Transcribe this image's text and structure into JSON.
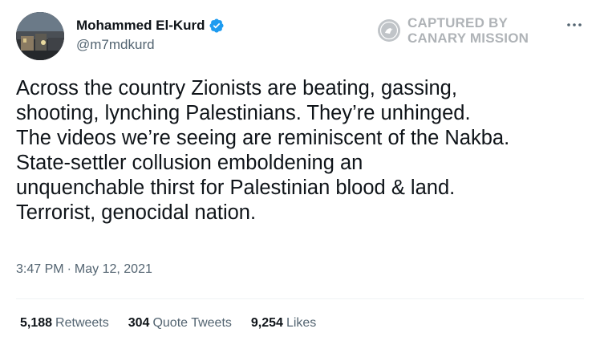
{
  "author": {
    "display_name": "Mohammed El-Kurd",
    "handle": "@m7mdkurd",
    "verified": true
  },
  "watermark": {
    "line1": "CAPTURED BY",
    "line2": "CANARY MISSION"
  },
  "tweet": {
    "text": "Across the country Zionists are beating, gassing,\nshooting, lynching Palestinians. They’re unhinged.\nThe videos we’re seeing are reminiscent of the Nakba.\nState-settler collusion emboldening an\nunquenchable thirst for Palestinian blood & land.\nTerrorist, genocidal nation.",
    "time": "3:47 PM",
    "separator": "·",
    "date": "May 12, 2021"
  },
  "stats": {
    "retweets": {
      "count": "5,188",
      "label": "Retweets"
    },
    "quote_tweets": {
      "count": "304",
      "label": "Quote Tweets"
    },
    "likes": {
      "count": "9,254",
      "label": "Likes"
    }
  },
  "colors": {
    "verified_badge": "#1d9bf0",
    "text_primary": "#0f1419",
    "text_secondary": "#536471"
  },
  "icons": [
    "verified-badge-icon",
    "more-options-icon",
    "watermark-seal-icon"
  ]
}
